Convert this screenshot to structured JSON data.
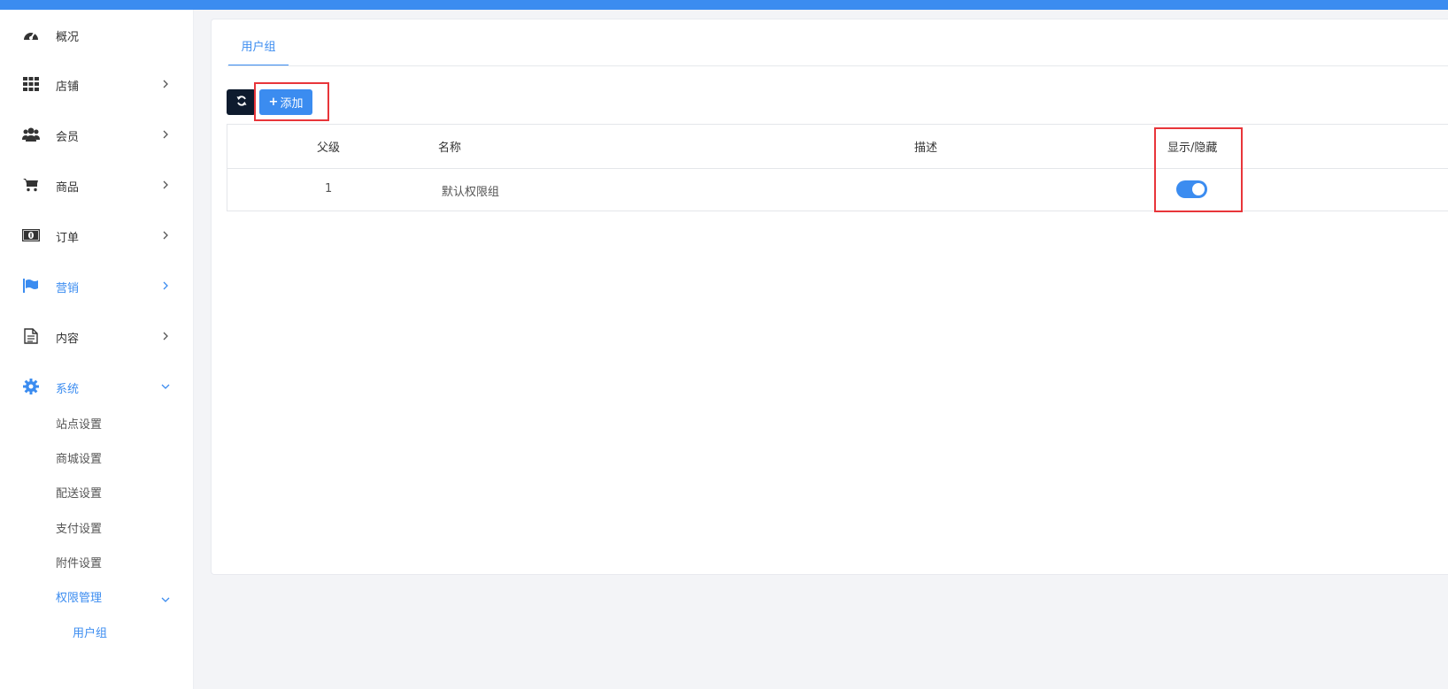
{
  "sidebar": {
    "items": [
      {
        "label": "概况",
        "icon": "dashboard-icon"
      },
      {
        "label": "店铺",
        "icon": "grid-icon"
      },
      {
        "label": "会员",
        "icon": "users-icon"
      },
      {
        "label": "商品",
        "icon": "cart-icon"
      },
      {
        "label": "订单",
        "icon": "money-icon"
      },
      {
        "label": "营销",
        "icon": "flag-icon"
      },
      {
        "label": "内容",
        "icon": "document-icon"
      },
      {
        "label": "系统",
        "icon": "gear-icon"
      }
    ],
    "system_sub": [
      "站点设置",
      "商城设置",
      "配送设置",
      "支付设置",
      "附件设置",
      "权限管理"
    ],
    "permission_sub": [
      "用户组"
    ]
  },
  "tabs": [
    "用户组"
  ],
  "toolbar": {
    "add_label": "添加"
  },
  "table": {
    "headers": [
      "父级",
      "名称",
      "描述",
      "显示/隐藏"
    ],
    "rows": [
      {
        "parent": "1",
        "name": "默认权限组",
        "description": "",
        "visible": true
      }
    ]
  },
  "colors": {
    "accent": "#3b8cf0",
    "dark_button": "#0e1b2e",
    "annotation": "#e8353a"
  }
}
